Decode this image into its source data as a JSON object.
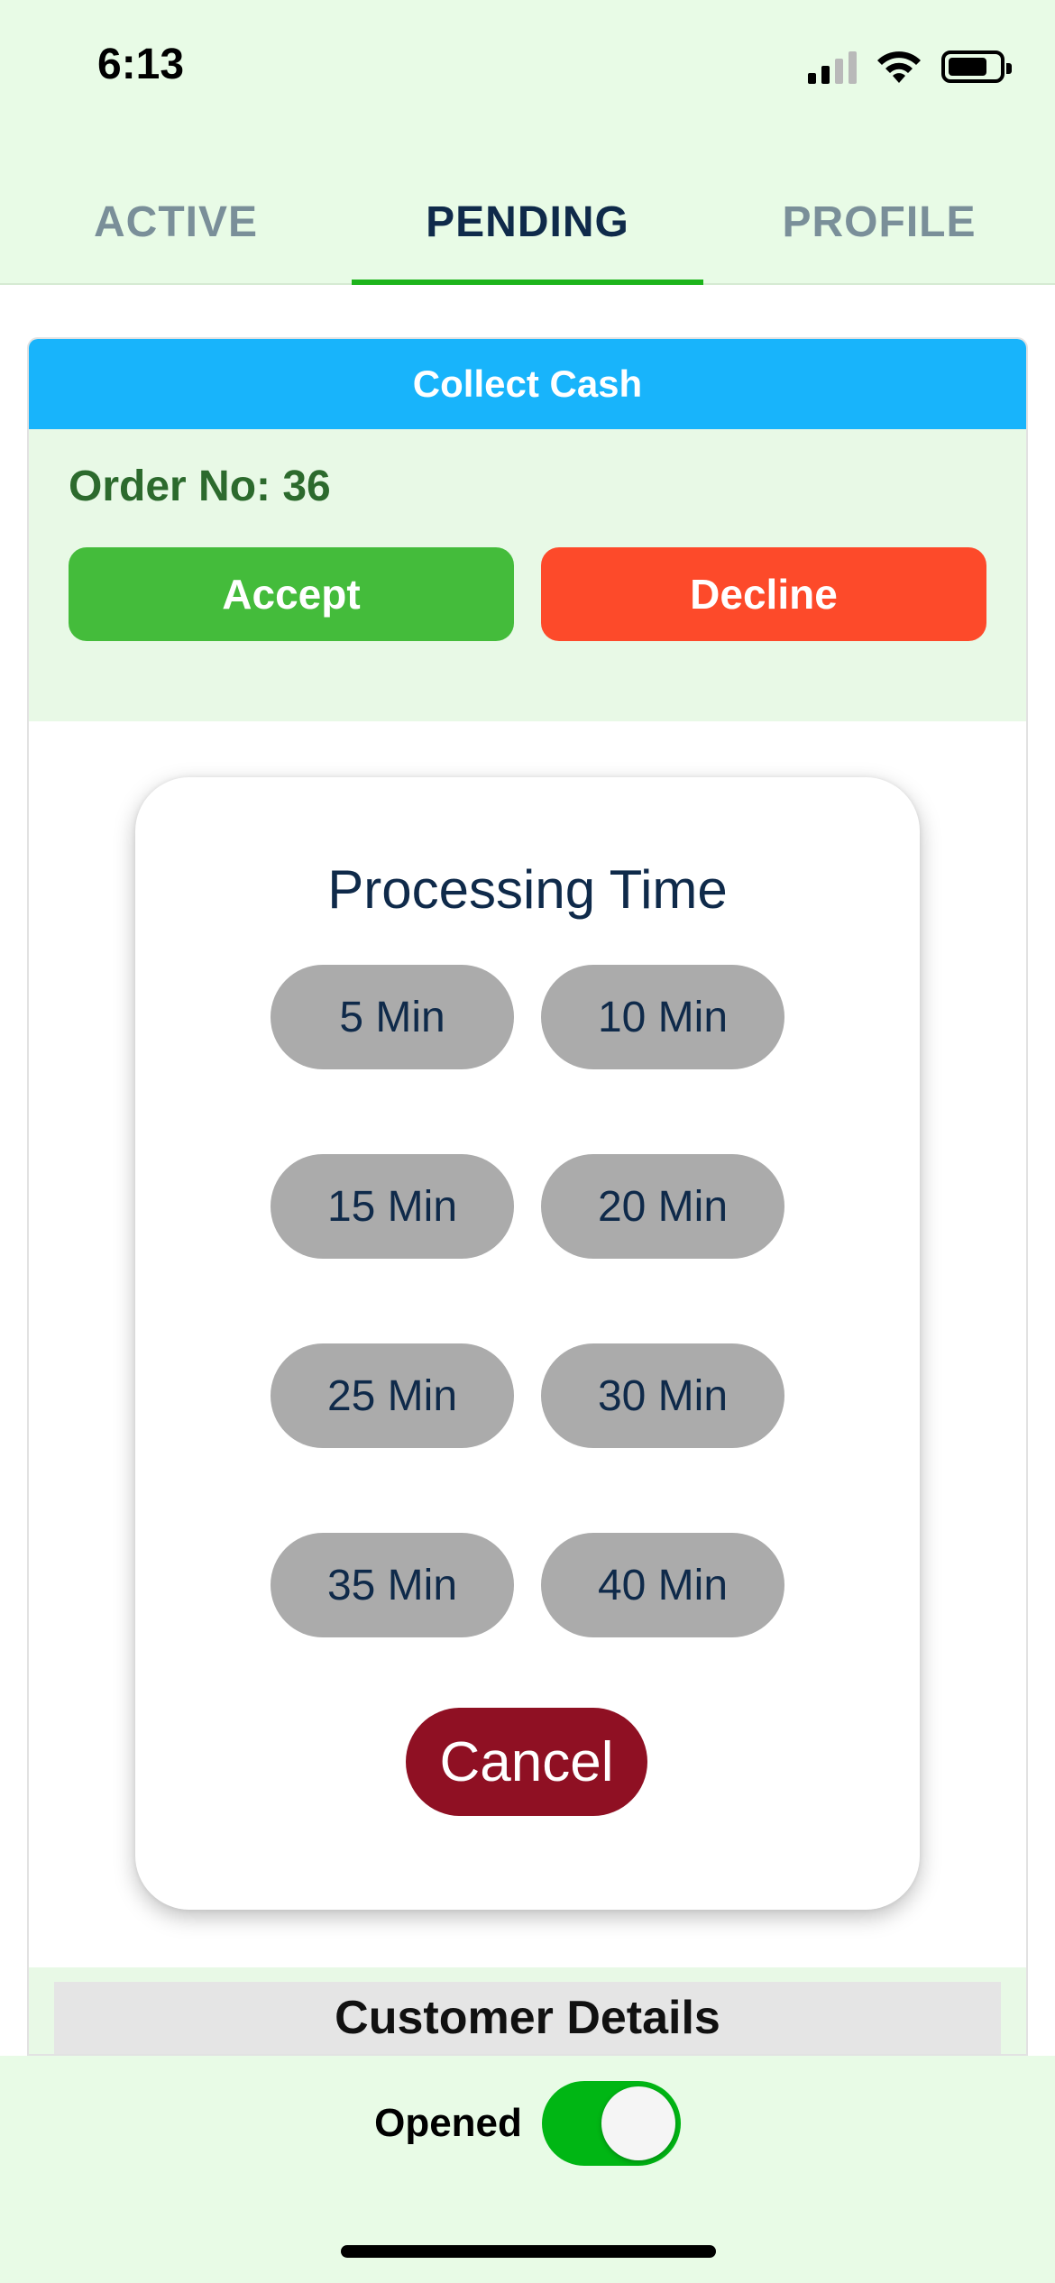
{
  "status_bar": {
    "time": "6:13",
    "icons": [
      "cellular-signal-icon",
      "wifi-icon",
      "battery-icon"
    ]
  },
  "tabs": [
    {
      "label": "ACTIVE",
      "active": false
    },
    {
      "label": "PENDING",
      "active": true
    },
    {
      "label": "PROFILE",
      "active": false
    }
  ],
  "order": {
    "header": "Collect Cash",
    "order_no": "Order No: 36",
    "accept_label": "Accept",
    "decline_label": "Decline",
    "customer_details_label": "Customer Details"
  },
  "modal": {
    "title": "Processing Time",
    "options": [
      "5 Min",
      "10 Min",
      "15 Min",
      "20 Min",
      "25 Min",
      "30 Min",
      "35 Min",
      "40 Min"
    ],
    "cancel_label": "Cancel"
  },
  "bottom": {
    "toggle_label": "Opened",
    "toggle_on": true
  },
  "colors": {
    "accent_green": "#1db41b",
    "header_blue": "#18b4fb",
    "accept_green": "#44bc3b",
    "decline_red": "#fd4a2a",
    "cancel_maroon": "#8f1023",
    "pill_gray": "#ababab",
    "background_mint": "#e8fbe6"
  }
}
